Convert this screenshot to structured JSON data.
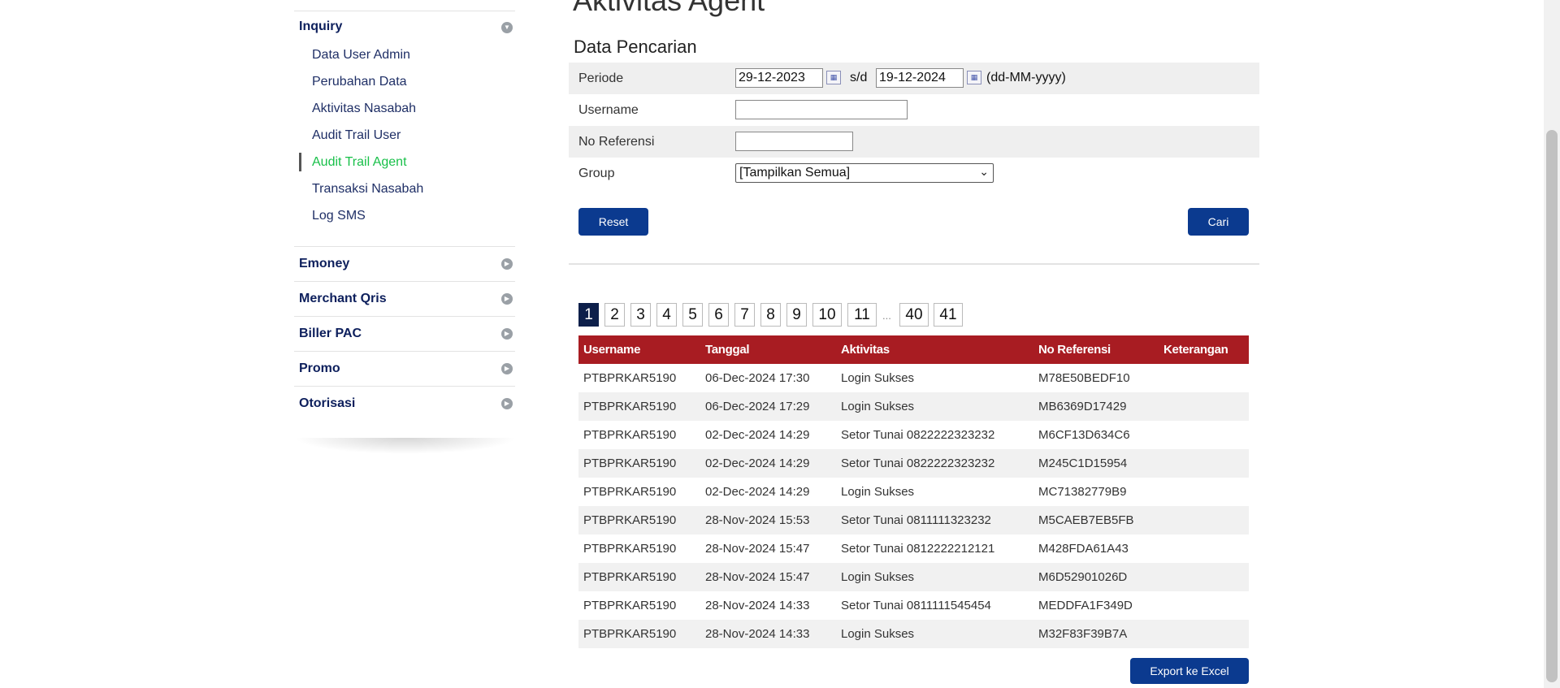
{
  "sidebar": {
    "inquiry": {
      "label": "Inquiry",
      "items": [
        "Data User Admin",
        "Perubahan Data",
        "Aktivitas Nasabah",
        "Audit Trail User",
        "Audit Trail Agent",
        "Transaksi Nasabah",
        "Log SMS"
      ],
      "active_item": "Audit Trail Agent"
    },
    "sections": [
      "Emoney",
      "Merchant Qris",
      "Biller PAC",
      "Promo",
      "Otorisasi"
    ]
  },
  "page": {
    "title": "Aktivitas Agent",
    "section_title": "Data Pencarian"
  },
  "form": {
    "periode_label": "Periode",
    "date_from": "29-12-2023",
    "sd_label": "s/d",
    "date_to": "19-12-2024",
    "date_format_hint": "(dd-MM-yyyy)",
    "username_label": "Username",
    "username_value": "",
    "noref_label": "No Referensi",
    "noref_value": "",
    "group_label": "Group",
    "group_selected": "[Tampilkan Semua]",
    "reset_label": "Reset",
    "search_label": "Cari"
  },
  "pagination": {
    "pages": [
      "1",
      "2",
      "3",
      "4",
      "5",
      "6",
      "7",
      "8",
      "9",
      "10",
      "11"
    ],
    "ellipsis": "...",
    "tail_pages": [
      "40",
      "41"
    ],
    "current": "1"
  },
  "table": {
    "columns": [
      "Username",
      "Tanggal",
      "Aktivitas",
      "No Referensi",
      "Keterangan"
    ],
    "rows": [
      [
        "PTBPRKAR5190",
        "06-Dec-2024 17:30",
        "Login Sukses",
        "M78E50BEDF10",
        ""
      ],
      [
        "PTBPRKAR5190",
        "06-Dec-2024 17:29",
        "Login Sukses",
        "MB6369D17429",
        ""
      ],
      [
        "PTBPRKAR5190",
        "02-Dec-2024 14:29",
        "Setor Tunai 0822222323232",
        "M6CF13D634C6",
        ""
      ],
      [
        "PTBPRKAR5190",
        "02-Dec-2024 14:29",
        "Setor Tunai 0822222323232",
        "M245C1D15954",
        ""
      ],
      [
        "PTBPRKAR5190",
        "02-Dec-2024 14:29",
        "Login Sukses",
        "MC71382779B9",
        ""
      ],
      [
        "PTBPRKAR5190",
        "28-Nov-2024 15:53",
        "Setor Tunai 0811111323232",
        "M5CAEB7EB5FB",
        ""
      ],
      [
        "PTBPRKAR5190",
        "28-Nov-2024 15:47",
        "Setor Tunai 0812222212121",
        "M428FDA61A43",
        ""
      ],
      [
        "PTBPRKAR5190",
        "28-Nov-2024 15:47",
        "Login Sukses",
        "M6D52901026D",
        ""
      ],
      [
        "PTBPRKAR5190",
        "28-Nov-2024 14:33",
        "Setor Tunai 0811111545454",
        "MEDDFA1F349D",
        ""
      ],
      [
        "PTBPRKAR5190",
        "28-Nov-2024 14:33",
        "Login Sukses",
        "M32F83F39B7A",
        ""
      ]
    ]
  },
  "export_label": "Export ke Excel",
  "icons": {
    "calendar": "calendar-icon",
    "section_arrow": "chevron-right-circle-icon",
    "expanded_arrow": "chevron-down-circle-icon",
    "select_chevron": "chevron-down-icon"
  },
  "colors": {
    "nav_text": "#0d1f5c",
    "active_item": "#19c04a",
    "table_header": "#a81c22",
    "button": "#0b3a8f",
    "pager_active": "#0d1f4a"
  }
}
